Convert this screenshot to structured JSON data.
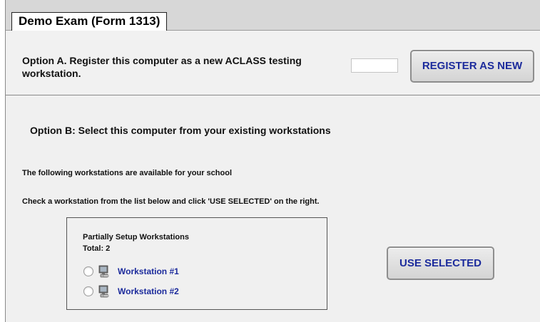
{
  "header": {
    "title": "Demo Exam (Form 1313)"
  },
  "option_a": {
    "text": "Option A. Register this computer as a new ACLASS testing workstation.",
    "input_value": "",
    "button_label": "REGISTER AS NEW"
  },
  "option_b": {
    "heading": "Option B: Select this computer from your existing workstations",
    "available_text": "The following workstations are available for your school",
    "instruction_text": "Check a workstation from the list below and click 'USE SELECTED' on the right.",
    "list_heading": "Partially Setup Workstations",
    "total_text": "Total: 2",
    "workstations": [
      {
        "label": "Workstation #1",
        "icon": "computer-icon"
      },
      {
        "label": "Workstation #2",
        "icon": "computer-icon"
      }
    ],
    "button_label": "USE SELECTED"
  },
  "colors": {
    "link": "#1c2b9c",
    "header_bg": "#d7d7d7",
    "panel_bg": "#f0f0f0"
  }
}
